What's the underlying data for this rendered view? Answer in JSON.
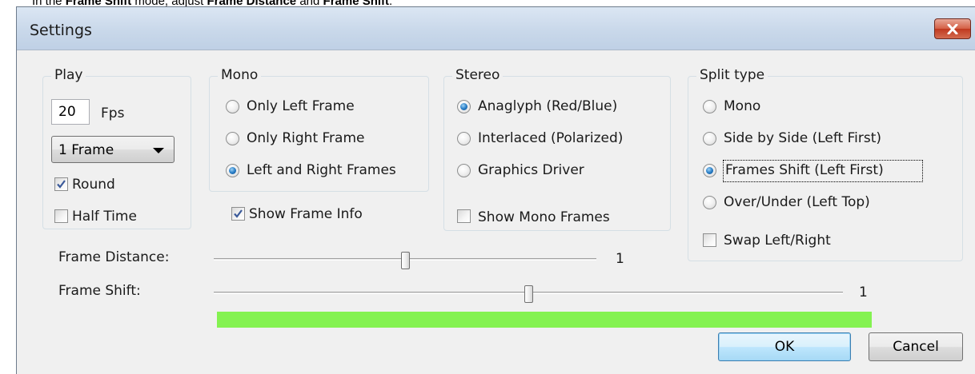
{
  "caption": {
    "prefix": "In the ",
    "mode": "Frame Shift",
    "middle": " mode, adjust ",
    "param1": "Frame Distance",
    "and": " and ",
    "param2": "Frame Shift",
    "suffix": "."
  },
  "window": {
    "title": "Settings",
    "close_icon": "close-icon"
  },
  "play": {
    "legend": "Play",
    "fps_value": "20",
    "fps_unit": "Fps",
    "frames_select": "1 Frame",
    "round_label": "Round",
    "round_checked": true,
    "halftime_label": "Half Time",
    "halftime_checked": false
  },
  "mono": {
    "legend": "Mono",
    "options": [
      "Only Left Frame",
      "Only Right Frame",
      "Left and Right Frames"
    ],
    "selected": 2,
    "show_frame_info_label": "Show Frame Info",
    "show_frame_info_checked": true
  },
  "stereo": {
    "legend": "Stereo",
    "options": [
      "Anaglyph (Red/Blue)",
      "Interlaced (Polarized)",
      "Graphics Driver"
    ],
    "selected": 0,
    "show_mono_frames_label": "Show Mono Frames",
    "show_mono_frames_checked": false
  },
  "split": {
    "legend": "Split type",
    "options": [
      "Mono",
      "Side by Side (Left First)",
      "Frames Shift (Left First)",
      "Over/Under (Left Top)"
    ],
    "selected": 2,
    "swap_label": "Swap Left/Right",
    "swap_checked": false
  },
  "frame_distance": {
    "label": "Frame Distance:",
    "value": "1",
    "position_fraction": 0.5
  },
  "frame_shift": {
    "label": "Frame Shift:",
    "value": "1",
    "position_fraction": 0.5
  },
  "progress": {
    "fraction": 1.0,
    "color": "#84f251"
  },
  "buttons": {
    "ok": "OK",
    "cancel": "Cancel"
  },
  "colors": {
    "selected_radio": "#2a7fc8",
    "close_button": "#c0391f"
  }
}
